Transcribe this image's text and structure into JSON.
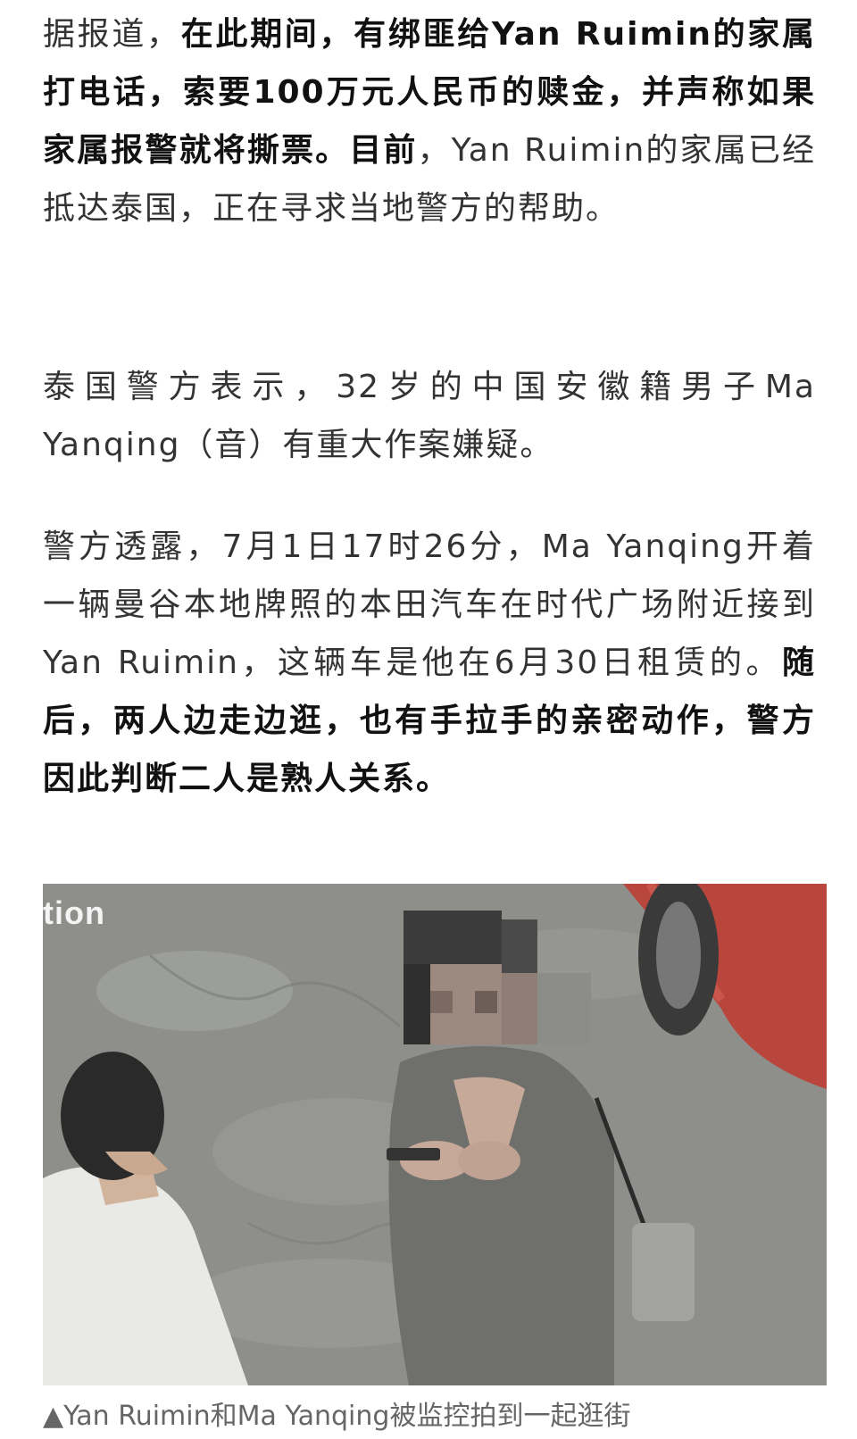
{
  "paragraph1": {
    "t1": "据报道，",
    "b1": "在此期间，有绑匪给Yan Ruimin的家属打电话，索要100万元人民币的赎金，并声称如果家属报警就将撕票。目前",
    "t2": "，Yan Ruimin的家属已经抵达泰国，正在寻求当地警方的帮助。"
  },
  "paragraph2": {
    "t1": "泰国警方表示，32岁的中国安徽籍男子Ma Yanqing（音）有重大作案嫌疑。"
  },
  "paragraph3": {
    "t1": "警方透露，7月1日17时26分，Ma Yanqing开着一辆曼谷本地牌照的本田汽车在时代广场附近接到Yan Ruimin，这辆车是他在6月30日租赁的。",
    "b1": "随后，两人边走边逛，也有手拉手的亲密动作，警方因此判断二人是熟人关系。"
  },
  "photo": {
    "watermark": "tion",
    "caption": "▲Yan Ruimin和Ma Yanqing被监控拍到一起逛街"
  }
}
